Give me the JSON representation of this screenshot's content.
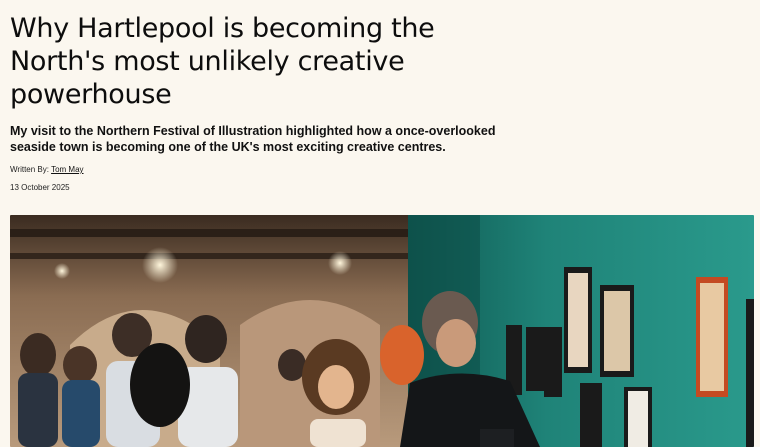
{
  "article": {
    "headline": "Why Hartlepool is becoming the North's most unlikely creative powerhouse",
    "standfirst": "My visit to the Northern Festival of Illustration highlighted how a once-overlooked seaside town is becoming one of the UK's most exciting creative centres.",
    "byline_prefix": "Written By: ",
    "author": "Tom May",
    "date": "13 October 2025"
  },
  "hero_image": {
    "alt": "photo-gallery-crowd",
    "colors": {
      "teal_wall": "#1f8378",
      "warm_room": "#a8876a",
      "frame_orange": "#d0502a",
      "jacket_orange": "#d9632c"
    }
  }
}
